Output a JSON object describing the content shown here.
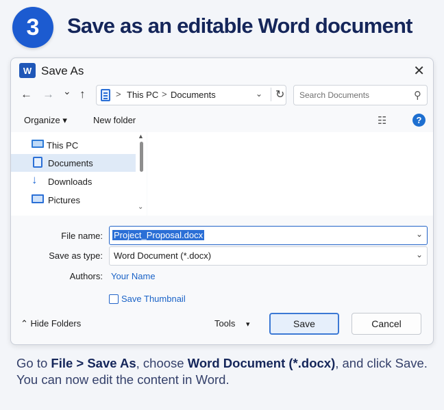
{
  "step": {
    "number": "3",
    "headline": "Save as an editable Word document"
  },
  "dialog": {
    "app_icon_letter": "W",
    "title": "Save As",
    "close_glyph": "✕",
    "nav": {
      "back_glyph": "←",
      "forward_glyph": "→",
      "recent_glyph": "⌄",
      "up_glyph": "↑",
      "address_separator": ">",
      "address_parts": [
        "This PC",
        "Documents"
      ],
      "address_dropdown_glyph": "⌄",
      "refresh_glyph": "↻",
      "search_placeholder": "Search Documents",
      "search_glyph": "⚲"
    },
    "toolbar": {
      "organize_label": "Organize ▾",
      "new_folder_label": "New folder",
      "list_view_glyph": "☷",
      "help_glyph": "?"
    },
    "nav_pane": {
      "items": [
        {
          "label": "This PC",
          "icon": "computer-icon",
          "selected": false
        },
        {
          "label": "Documents",
          "icon": "documents-icon",
          "selected": true
        },
        {
          "label": "Downloads",
          "icon": "download-icon",
          "selected": false
        },
        {
          "label": "Pictures",
          "icon": "pictures-icon",
          "selected": false
        }
      ],
      "scroll_up_glyph": "▲",
      "scroll_down_glyph": "⌄"
    },
    "form": {
      "file_name_label": "File name:",
      "file_name_value": "Project_Proposal.docx",
      "save_as_type_label": "Save as type:",
      "save_as_type_value": "Word Document (*.docx)",
      "dropdown_glyph": "⌄",
      "authors_label": "Authors:",
      "authors_value": "Your Name",
      "save_thumbnail_label": "Save Thumbnail",
      "save_thumbnail_checked": false
    },
    "footer": {
      "hide_folders_label": "⌃  Hide Folders",
      "tools_label": "Tools",
      "tools_dropdown_glyph": "▾",
      "save_label": "Save",
      "cancel_label": "Cancel"
    }
  },
  "caption": {
    "part1": "Go to ",
    "bold1": "File > Save As",
    "part2": ", choose ",
    "bold2": "Word Document (*.docx)",
    "part3": ", and click Save.",
    "line2": "You can now edit the content in Word."
  },
  "colors": {
    "badge": "#1c5bd0",
    "headline": "#15265a",
    "accent": "#2163c8",
    "selection": "#dfeaf7",
    "link": "#1a63c7"
  }
}
